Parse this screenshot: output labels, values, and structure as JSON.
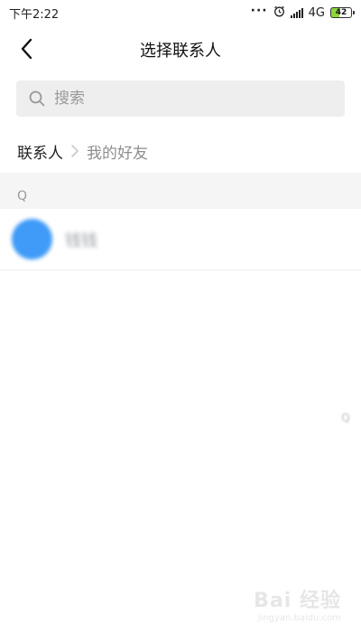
{
  "status_bar": {
    "time": "下午2:22",
    "network": "4G",
    "battery": "42"
  },
  "header": {
    "title": "选择联系人"
  },
  "search": {
    "placeholder": "搜索"
  },
  "breadcrumb": {
    "root": "联系人",
    "current": "我的好友"
  },
  "contacts": {
    "section_letter": "Q",
    "items": [
      {
        "name": "钱钱"
      }
    ]
  },
  "index": {
    "letter": "Q"
  },
  "watermark": {
    "brand": "Bai 经验",
    "url": "jingyan.baidu.com"
  },
  "colors": {
    "avatar": "#3f9bf7",
    "section_bg": "#f5f5f5",
    "search_bg": "#eeeeee",
    "battery_fill": "#8dd63a"
  }
}
